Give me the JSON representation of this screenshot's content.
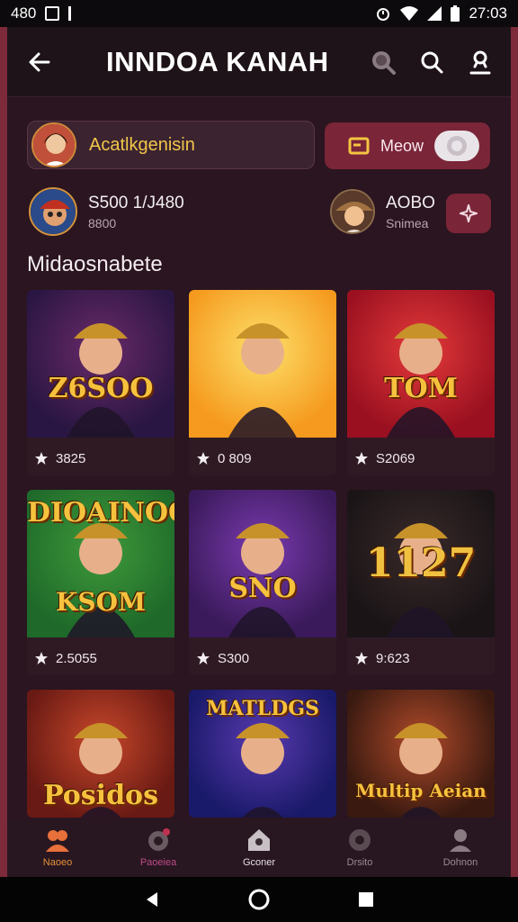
{
  "status_bar": {
    "left_text": "480",
    "time": "27:03"
  },
  "header": {
    "title": "INNDOA KANAH"
  },
  "profile": {
    "name": "Acatlkgenisin"
  },
  "mode": {
    "label": "Meow"
  },
  "stats": {
    "left": {
      "value": "S500 1/J480",
      "sub": "8800"
    },
    "right": {
      "value": "AOBO",
      "sub": "Snimea"
    }
  },
  "section": {
    "title": "Midaosnabete"
  },
  "games": [
    {
      "art_label": "Z6SOO",
      "value": "3825",
      "colors": [
        "#2a1642",
        "#6a2a6a"
      ]
    },
    {
      "art_label": "",
      "value": "0 809",
      "colors": [
        "#f59a1e",
        "#fde06a"
      ]
    },
    {
      "art_label": "TOM",
      "value": "S2069",
      "colors": [
        "#9a1020",
        "#e43a3a"
      ]
    },
    {
      "art_label": "DIOAINOO",
      "sub_label": "KSOM",
      "value": "2.5055",
      "colors": [
        "#1f6a2a",
        "#3f9a3a"
      ]
    },
    {
      "art_label": "SNO",
      "value": "S300",
      "colors": [
        "#3a1a5a",
        "#7a3ab0"
      ]
    },
    {
      "art_label": "1127",
      "value": "9:623",
      "colors": [
        "#1a1416",
        "#3a2a2a"
      ]
    },
    {
      "art_label": "Posidos",
      "value": "",
      "colors": [
        "#6a1a14",
        "#c8482a"
      ]
    },
    {
      "art_label": "MATLDGS",
      "value": "",
      "colors": [
        "#1a1a6a",
        "#5a3ab0"
      ]
    },
    {
      "art_label": "Multip Aeian",
      "value": "",
      "colors": [
        "#3a1a10",
        "#b04a2a"
      ]
    }
  ],
  "bottom_nav": [
    {
      "label": "Naoeo",
      "active": true
    },
    {
      "label": "Paoeiea",
      "active": false
    },
    {
      "label": "Gconer",
      "active": false
    },
    {
      "label": "Drsito",
      "active": false
    },
    {
      "label": "Dohnon",
      "active": false
    }
  ],
  "colors": {
    "accent": "#7a2538",
    "gold": "#f1c64a",
    "background": "#2a1520"
  }
}
